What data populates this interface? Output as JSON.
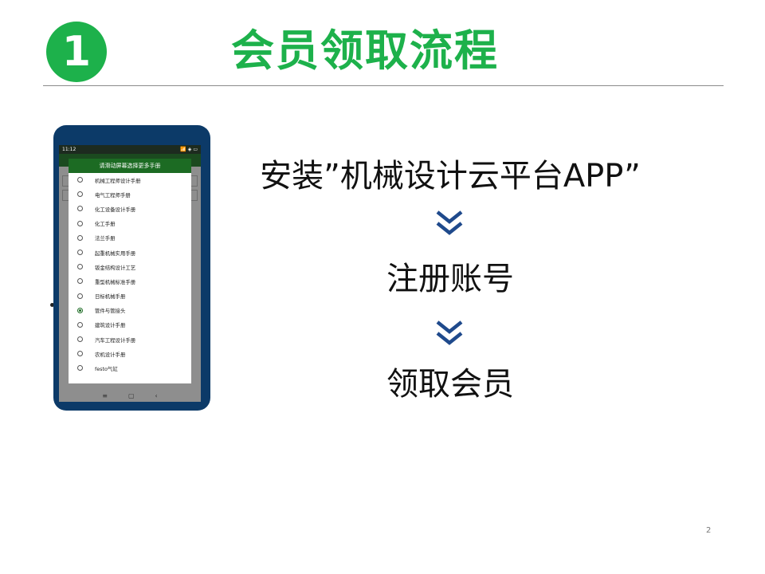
{
  "header": {
    "step_number": "1",
    "title": "会员领取流程"
  },
  "phone": {
    "status_time": "11:12",
    "status_icons": "📶 ◈ ▭",
    "dialog_title": "请滑动屏幕选择更多手册",
    "options": [
      {
        "label": "机械工程师设计手册",
        "selected": false
      },
      {
        "label": "电气工程师手册",
        "selected": false
      },
      {
        "label": "化工设备设计手册",
        "selected": false
      },
      {
        "label": "化工手册",
        "selected": false
      },
      {
        "label": "法兰手册",
        "selected": false
      },
      {
        "label": "起重机械实用手册",
        "selected": false
      },
      {
        "label": "钣金结构设计工艺",
        "selected": false
      },
      {
        "label": "重型机械标准手册",
        "selected": false
      },
      {
        "label": "日标机械手册",
        "selected": false
      },
      {
        "label": "管件与管接头",
        "selected": true
      },
      {
        "label": "建筑设计手册",
        "selected": false
      },
      {
        "label": "汽车工程设计手册",
        "selected": false
      },
      {
        "label": "农机设计手册",
        "selected": false
      },
      {
        "label": "festo气缸",
        "selected": false
      }
    ],
    "nav": {
      "menu": "≡",
      "home": "▢",
      "back": "‹"
    }
  },
  "steps": {
    "install": "安装”机械设计云平台APP”",
    "register": "注册账号",
    "claim": "领取会员"
  },
  "icons": {
    "arrow": "double-chevron-down-icon"
  },
  "colors": {
    "accent": "#1db14b",
    "arrow": "#1f4a8c",
    "phone_frame": "#0c3a68"
  },
  "page_number": "2"
}
